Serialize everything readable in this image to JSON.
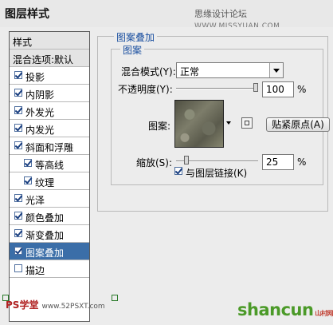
{
  "window": {
    "title": "图层样式",
    "watermark_text": "思缘设计论坛",
    "watermark_url": "WWW.MISSYUAN.COM"
  },
  "style_list": {
    "header": "样式",
    "blend_options": "混合选项:默认",
    "items": [
      {
        "label": "投影",
        "checked": true
      },
      {
        "label": "内阴影",
        "checked": true
      },
      {
        "label": "外发光",
        "checked": true
      },
      {
        "label": "内发光",
        "checked": true
      },
      {
        "label": "斜面和浮雕",
        "checked": true
      },
      {
        "label": "等高线",
        "checked": true
      },
      {
        "label": "纹理",
        "checked": true
      },
      {
        "label": "光泽",
        "checked": true
      },
      {
        "label": "颜色叠加",
        "checked": true
      },
      {
        "label": "渐变叠加",
        "checked": true
      },
      {
        "label": "图案叠加",
        "checked": true,
        "selected": true
      },
      {
        "label": "描边",
        "checked": false
      }
    ]
  },
  "panel": {
    "group_title": "图案叠加",
    "sub_group_title": "图案",
    "blend_mode_label": "混合模式(Y):",
    "blend_mode_value": "正常",
    "opacity_label": "不透明度(Y):",
    "opacity_value": "100",
    "opacity_unit": "%",
    "opacity_fraction": 1.0,
    "pattern_label": "图案:",
    "snap_button": "贴紧原点(A)",
    "scale_label": "缩放(S):",
    "scale_value": "25",
    "scale_unit": "%",
    "scale_fraction": 0.02,
    "link_label": "与图层链接(K)",
    "link_checked": true
  },
  "footer": {
    "left_mark": "PS学堂",
    "left_sub": "www.52PSXT.com",
    "brand": "shancun",
    "brand_cn": "山村网"
  },
  "colors": {
    "selected_row": "#3b6ea8",
    "group_title": "#1a4fa0",
    "brand": "#4b9a28"
  }
}
